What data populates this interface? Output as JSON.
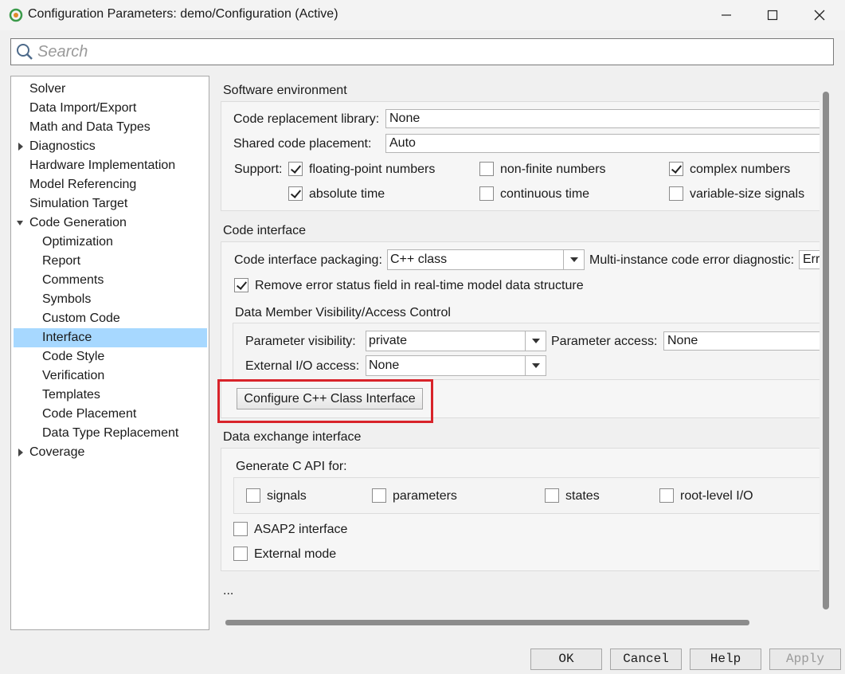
{
  "window": {
    "title": "Configuration Parameters: demo/Configuration (Active)"
  },
  "search": {
    "placeholder": "Search"
  },
  "tree": {
    "items": [
      {
        "label": "Solver"
      },
      {
        "label": "Data Import/Export"
      },
      {
        "label": "Math and Data Types"
      },
      {
        "label": "Diagnostics",
        "expander": "collapsed"
      },
      {
        "label": "Hardware Implementation"
      },
      {
        "label": "Model Referencing"
      },
      {
        "label": "Simulation Target"
      },
      {
        "label": "Code Generation",
        "expander": "expanded"
      },
      {
        "label": "Optimization"
      },
      {
        "label": "Report"
      },
      {
        "label": "Comments"
      },
      {
        "label": "Symbols"
      },
      {
        "label": "Custom Code"
      },
      {
        "label": "Interface",
        "selected": true
      },
      {
        "label": "Code Style"
      },
      {
        "label": "Verification"
      },
      {
        "label": "Templates"
      },
      {
        "label": "Code Placement"
      },
      {
        "label": "Data Type Replacement"
      },
      {
        "label": "Coverage",
        "expander": "collapsed"
      }
    ]
  },
  "software_env": {
    "title": "Software environment",
    "crl_label": "Code replacement library:",
    "crl_value": "None",
    "shared_label": "Shared code placement:",
    "shared_value": "Auto",
    "support_label": "Support:",
    "options": [
      {
        "label": "floating-point numbers",
        "checked": true
      },
      {
        "label": "non-finite numbers",
        "checked": false
      },
      {
        "label": "complex numbers",
        "checked": true
      },
      {
        "label": "absolute time",
        "checked": true
      },
      {
        "label": "continuous time",
        "checked": false
      },
      {
        "label": "variable-size signals",
        "checked": false
      }
    ]
  },
  "code_interface": {
    "title": "Code interface",
    "packaging_label": "Code interface packaging:",
    "packaging_value": "C++ class",
    "multi_label": "Multi-instance code error diagnostic:",
    "multi_value": "Err",
    "remove_error_label": "Remove error status field in real-time model data structure",
    "remove_error_checked": true,
    "visibility": {
      "title": "Data Member Visibility/Access Control",
      "param_vis_label": "Parameter visibility:",
      "param_vis_value": "private",
      "param_access_label": "Parameter access:",
      "param_access_value": "None",
      "io_access_label": "External I/O access:",
      "io_access_value": "None"
    },
    "configure_button": "Configure C++ Class Interface"
  },
  "data_exchange": {
    "title": "Data exchange interface",
    "capi_label": "Generate C API for:",
    "capi_options": [
      {
        "label": "signals",
        "checked": false
      },
      {
        "label": "parameters",
        "checked": false
      },
      {
        "label": "states",
        "checked": false
      },
      {
        "label": "root-level I/O",
        "checked": false
      }
    ],
    "asap2_label": "ASAP2 interface",
    "external_mode_label": "External mode"
  },
  "more": "...",
  "footer": {
    "ok": "OK",
    "cancel": "Cancel",
    "help": "Help",
    "apply": "Apply"
  },
  "colors": {
    "selection": "#a7d8ff",
    "highlight_border": "#d8232a"
  },
  "icons": [
    "simulink-app-icon",
    "minimize-icon",
    "maximize-icon",
    "close-icon",
    "search-icon",
    "tree-expand-arrow-icon",
    "dropdown-arrow-icon"
  ]
}
